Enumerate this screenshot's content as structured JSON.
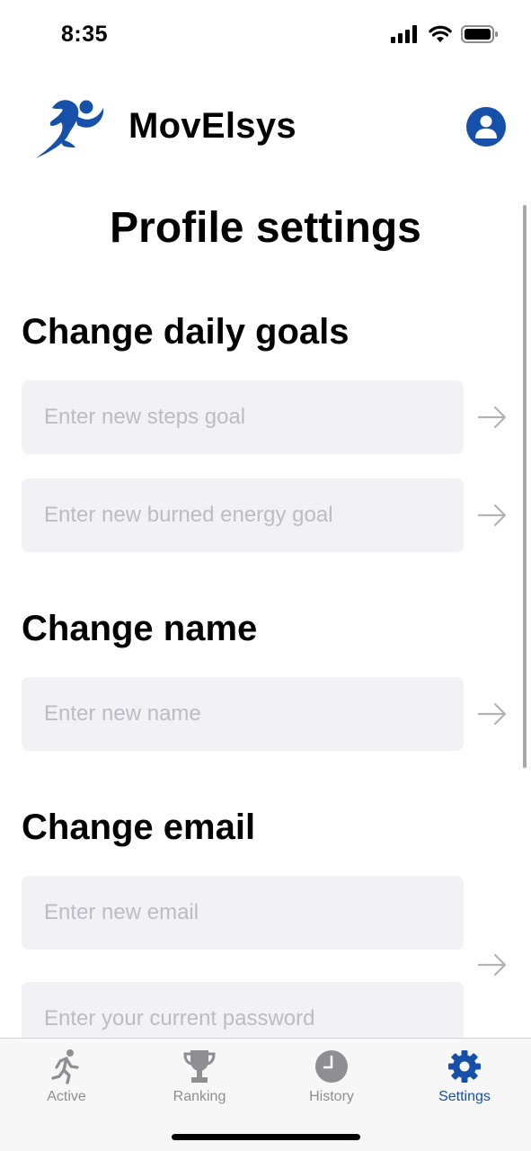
{
  "status_bar": {
    "time": "8:35",
    "icons": [
      "signal-icon",
      "wifi-icon",
      "battery-icon"
    ]
  },
  "header": {
    "app_name": "MovElsys",
    "logo": "runner-logo",
    "account_icon": "account-icon"
  },
  "colors": {
    "accent": "#1650a8",
    "field_bg": "#f1f1f6",
    "placeholder": "#bcbcc3",
    "inactive_tab": "#8e8e93"
  },
  "page": {
    "title": "Profile settings"
  },
  "sections": {
    "goals": {
      "title": "Change daily goals",
      "steps_placeholder": "Enter new steps goal",
      "energy_placeholder": "Enter new burned energy goal"
    },
    "name": {
      "title": "Change name",
      "name_placeholder": "Enter new name"
    },
    "email": {
      "title": "Change email",
      "email_placeholder": "Enter new email",
      "password_placeholder": "Enter your current password"
    }
  },
  "tab_bar": {
    "tabs": [
      {
        "label": "Active",
        "icon": "runner-icon"
      },
      {
        "label": "Ranking",
        "icon": "trophy-icon"
      },
      {
        "label": "History",
        "icon": "clock-icon"
      },
      {
        "label": "Settings",
        "icon": "gear-icon"
      }
    ],
    "selected": "Settings"
  }
}
